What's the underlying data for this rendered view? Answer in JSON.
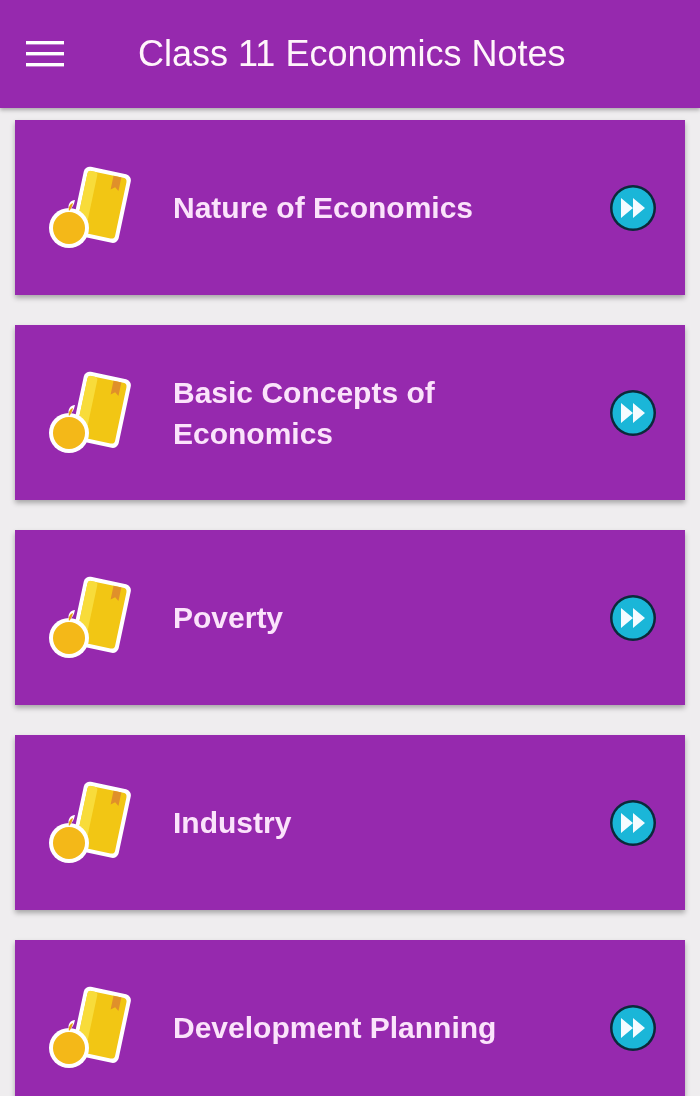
{
  "app_bar": {
    "title": "Class 11 Economics Notes"
  },
  "chapters": [
    {
      "title": "Nature of Economics"
    },
    {
      "title": "Basic Concepts of Economics"
    },
    {
      "title": "Poverty"
    },
    {
      "title": "Industry"
    },
    {
      "title": "Development Planning"
    }
  ]
}
